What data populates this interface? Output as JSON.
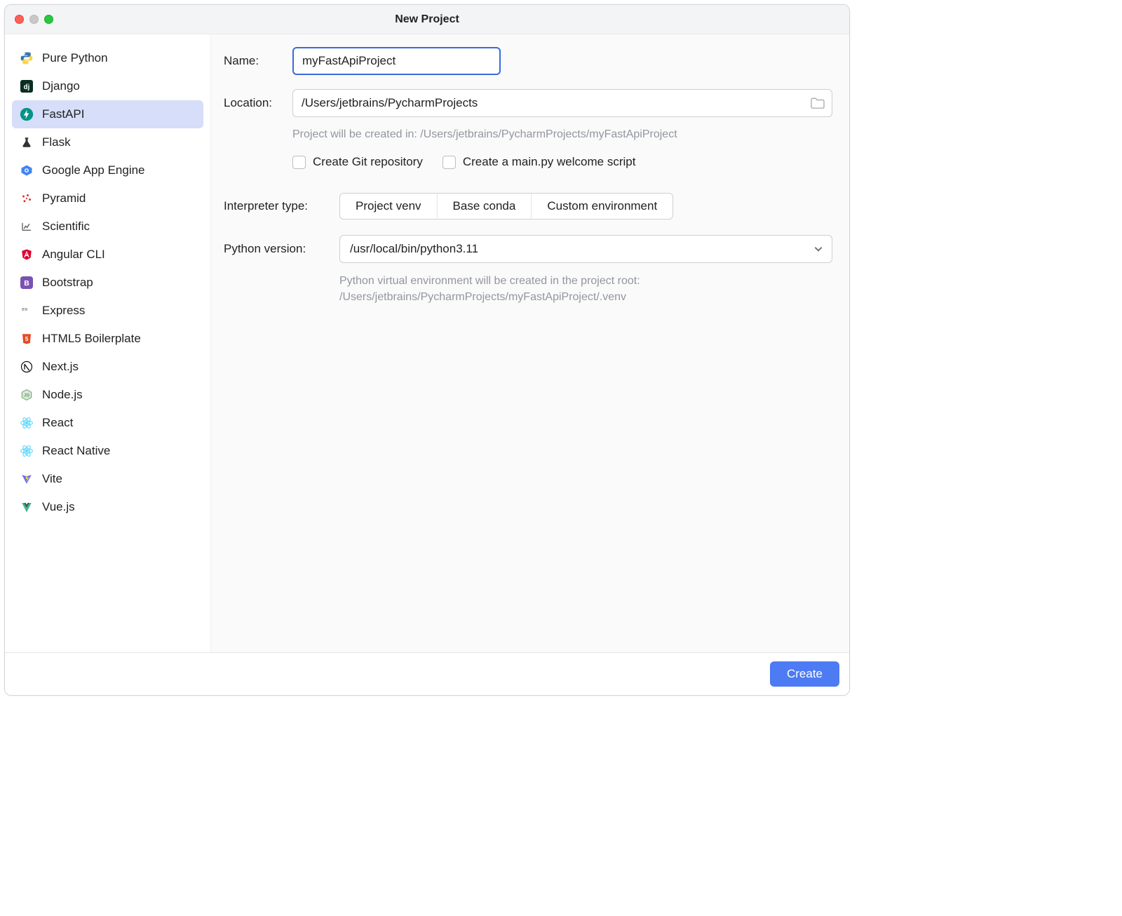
{
  "title": "New Project",
  "sidebar": {
    "items": [
      {
        "id": "pure-python",
        "label": "Pure Python"
      },
      {
        "id": "django",
        "label": "Django"
      },
      {
        "id": "fastapi",
        "label": "FastAPI",
        "selected": true
      },
      {
        "id": "flask",
        "label": "Flask"
      },
      {
        "id": "google-app-engine",
        "label": "Google App Engine"
      },
      {
        "id": "pyramid",
        "label": "Pyramid"
      },
      {
        "id": "scientific",
        "label": "Scientific"
      },
      {
        "id": "angular-cli",
        "label": "Angular CLI"
      },
      {
        "id": "bootstrap",
        "label": "Bootstrap"
      },
      {
        "id": "express",
        "label": "Express"
      },
      {
        "id": "html5-boilerplate",
        "label": "HTML5 Boilerplate"
      },
      {
        "id": "nextjs",
        "label": "Next.js"
      },
      {
        "id": "nodejs",
        "label": "Node.js"
      },
      {
        "id": "react",
        "label": "React"
      },
      {
        "id": "react-native",
        "label": "React Native"
      },
      {
        "id": "vite",
        "label": "Vite"
      },
      {
        "id": "vuejs",
        "label": "Vue.js"
      }
    ]
  },
  "form": {
    "name_label": "Name:",
    "name_value": "myFastApiProject",
    "location_label": "Location:",
    "location_value": "/Users/jetbrains/PycharmProjects",
    "creation_hint": "Project will be created in: /Users/jetbrains/PycharmProjects/myFastApiProject",
    "checkbox_git": "Create Git repository",
    "checkbox_main": "Create a main.py welcome script",
    "interpreter_label": "Interpreter type:",
    "interpreter_options": [
      "Project venv",
      "Base conda",
      "Custom environment"
    ],
    "python_version_label": "Python version:",
    "python_version_value": "/usr/local/bin/python3.11",
    "venv_hint_line1": "Python virtual environment will be created in the project root:",
    "venv_hint_line2": "/Users/jetbrains/PycharmProjects/myFastApiProject/.venv"
  },
  "footer": {
    "create_label": "Create"
  }
}
